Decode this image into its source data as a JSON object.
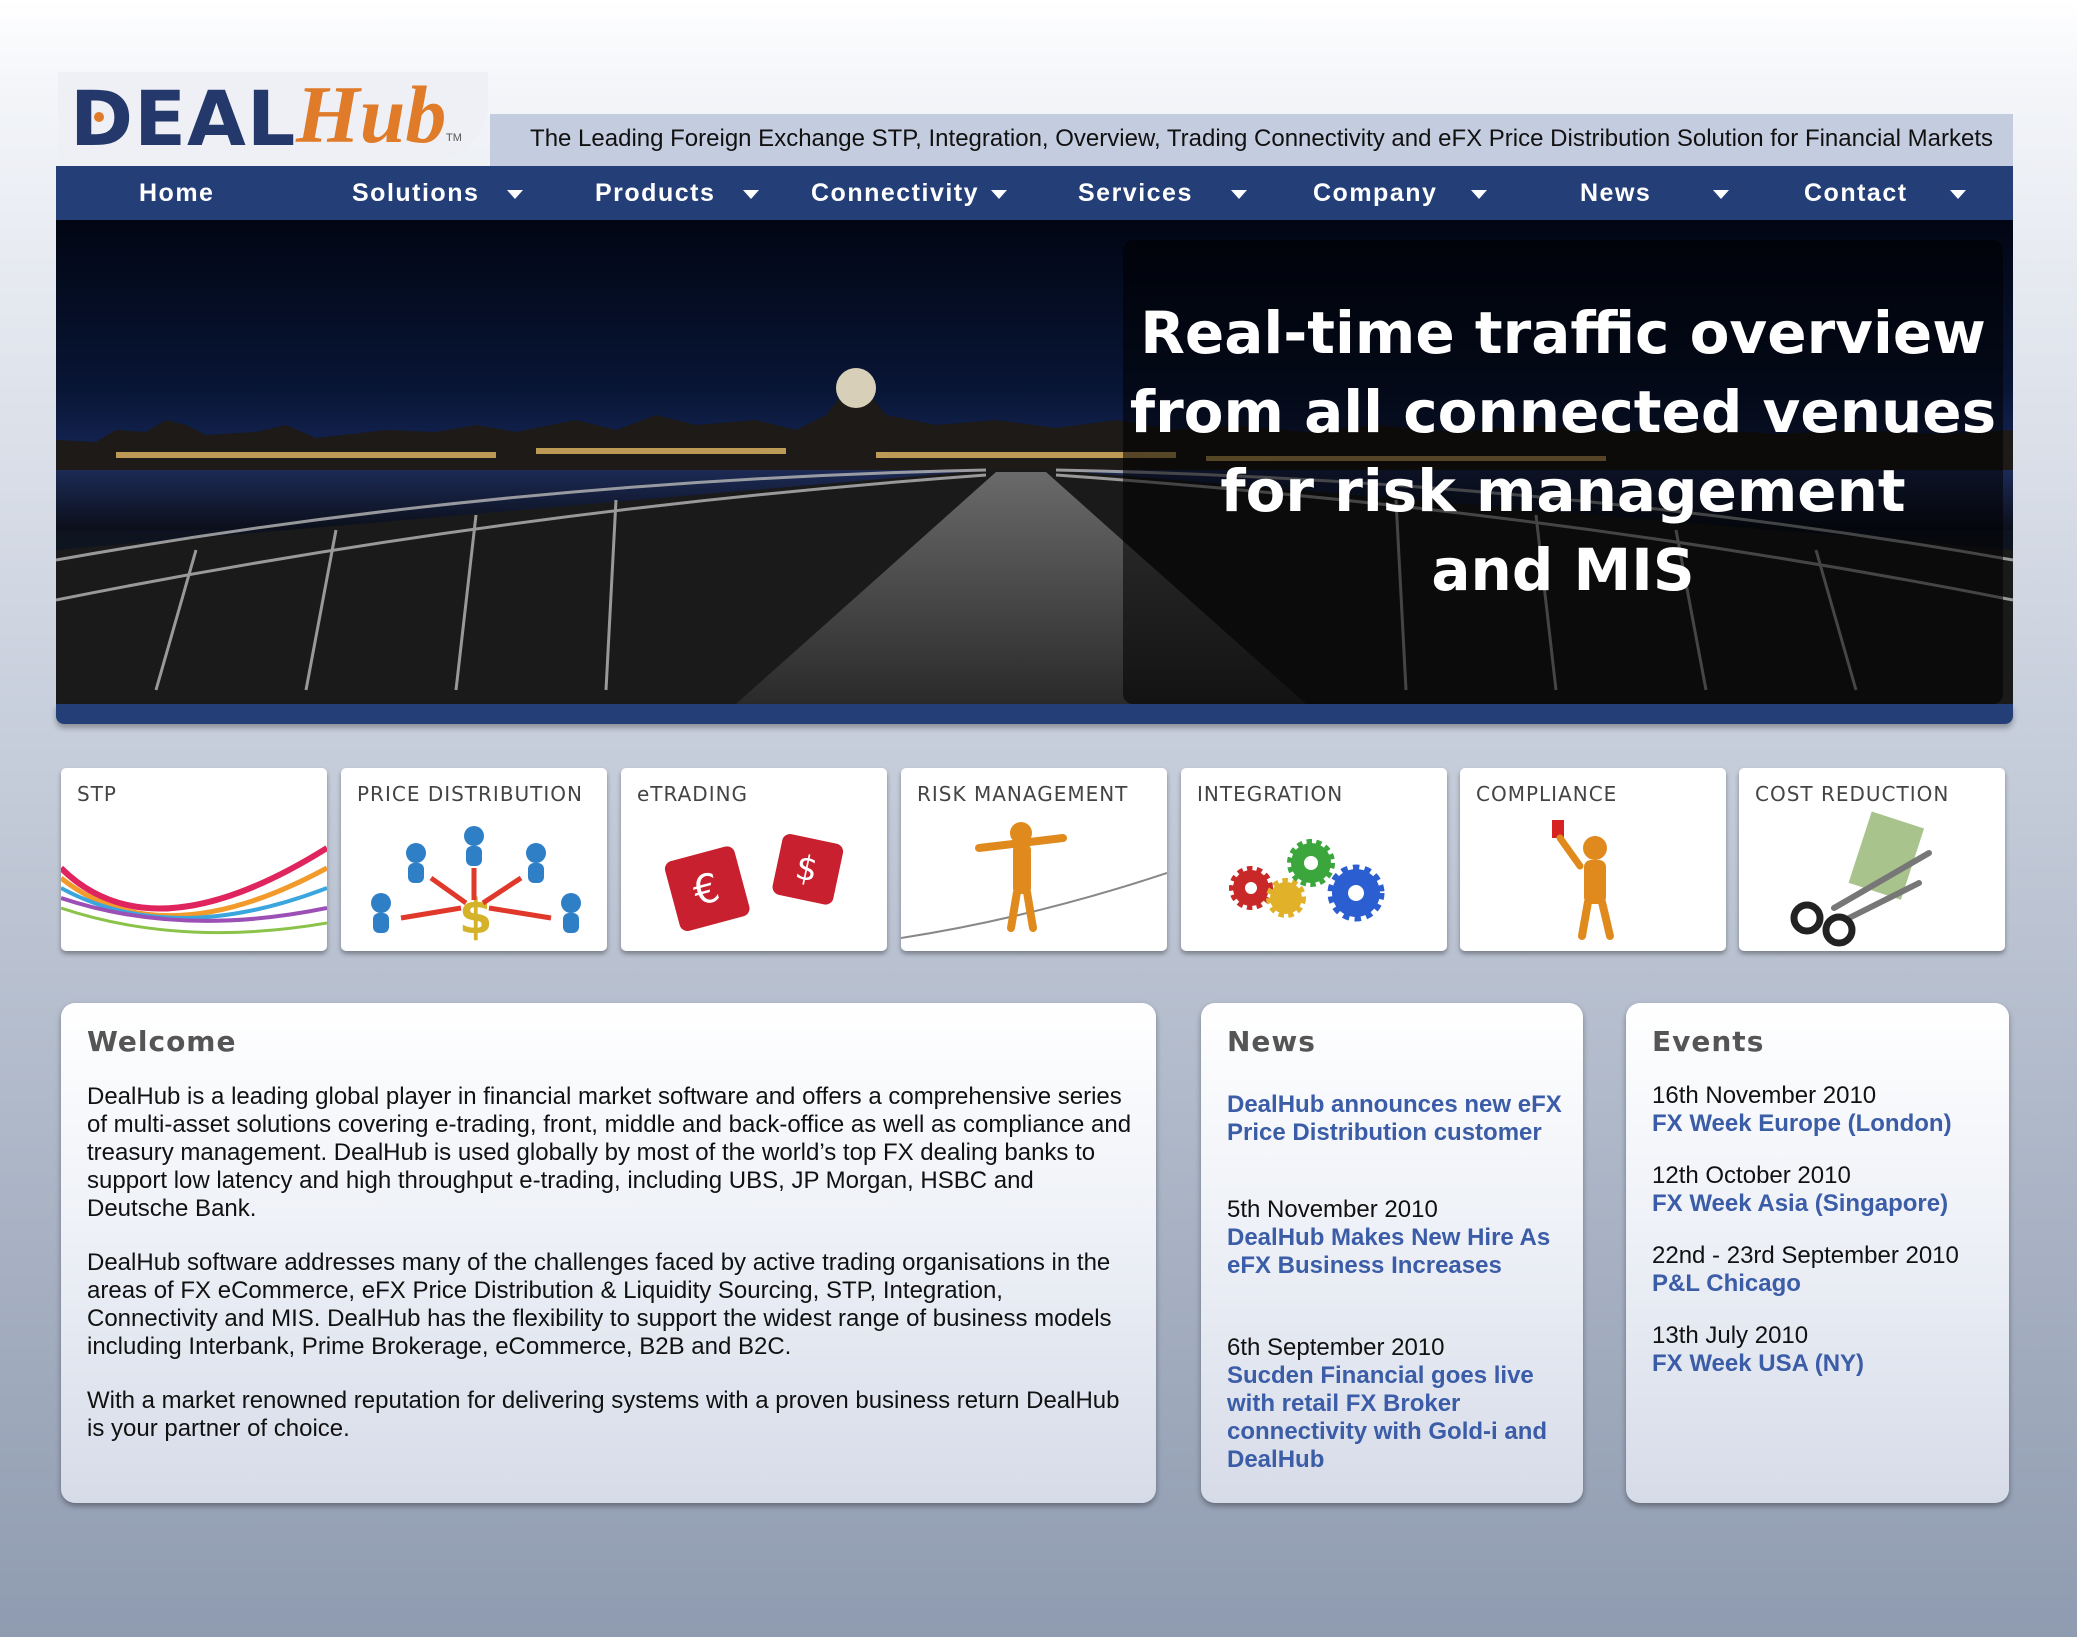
{
  "header": {
    "logo_deal": "DEAL",
    "logo_hub": "Hub",
    "logo_tm": "TM",
    "tagline": "The Leading Foreign Exchange STP, Integration, Overview, Trading Connectivity and eFX Price Distribution Solution for Financial Markets"
  },
  "nav": {
    "items": [
      {
        "label": "Home",
        "dropdown": false
      },
      {
        "label": "Solutions",
        "dropdown": true
      },
      {
        "label": "Products",
        "dropdown": true
      },
      {
        "label": "Connectivity",
        "dropdown": true
      },
      {
        "label": "Services",
        "dropdown": true
      },
      {
        "label": "Company",
        "dropdown": true
      },
      {
        "label": "News",
        "dropdown": true
      },
      {
        "label": "Contact",
        "dropdown": true
      }
    ]
  },
  "hero": {
    "line1": "Real-time traffic overview",
    "line2": "from all connected venues",
    "line3": "for risk management",
    "line4": "and MIS"
  },
  "tiles": [
    {
      "label": "STP",
      "icon": "stp-swoosh-icon"
    },
    {
      "label": "PRICE DISTRIBUTION",
      "icon": "price-distribution-icon"
    },
    {
      "label": "eTRADING",
      "icon": "buy-sell-dice-icon"
    },
    {
      "label": "RISK MANAGEMENT",
      "icon": "tightrope-figure-icon"
    },
    {
      "label": "INTEGRATION",
      "icon": "gears-icon"
    },
    {
      "label": "COMPLIANCE",
      "icon": "red-card-figure-icon"
    },
    {
      "label": "COST REDUCTION",
      "icon": "scissors-money-icon"
    }
  ],
  "welcome": {
    "title": "Welcome",
    "p1": "DealHub is a leading global player in financial market software and offers a comprehensive series of multi-asset solutions covering e-trading, front, middle and back-office as well as compliance and treasury management. DealHub is used globally by most of the world’s top FX dealing banks to support low latency and high throughput e-trading, including UBS, JP Morgan, HSBC and Deutsche Bank.",
    "p2": "DealHub software addresses many of the challenges faced by active trading organisations in the areas of FX eCommerce, eFX Price Distribution & Liquidity Sourcing, STP, Integration, Connectivity and MIS. DealHub has the flexibility to support the widest range of business models including Interbank, Prime Brokerage, eCommerce, B2B and B2C.",
    "p3": "With a market renowned reputation for delivering systems with a proven business return DealHub is your partner of choice."
  },
  "news": {
    "title": "News",
    "items": [
      {
        "date": "",
        "headline": "DealHub announces new eFX Price Distribution customer"
      },
      {
        "date": "5th November 2010",
        "headline": "DealHub Makes New Hire As eFX Business Increases"
      },
      {
        "date": "6th September 2010",
        "headline": "Sucden Financial goes live with retail FX Broker connectivity with Gold-i and DealHub"
      }
    ]
  },
  "events": {
    "title": "Events",
    "items": [
      {
        "date": "16th November 2010",
        "name": "FX Week Europe (London)"
      },
      {
        "date": "12th October 2010",
        "name": "FX Week Asia (Singapore)"
      },
      {
        "date": "22nd - 23rd September 2010",
        "name": "P&L Chicago"
      },
      {
        "date": "13th July 2010",
        "name": "FX Week USA (NY)"
      }
    ]
  },
  "colors": {
    "brand_navy": "#243f78",
    "brand_orange": "#e07b2a",
    "link_blue": "#3b5ca7"
  }
}
